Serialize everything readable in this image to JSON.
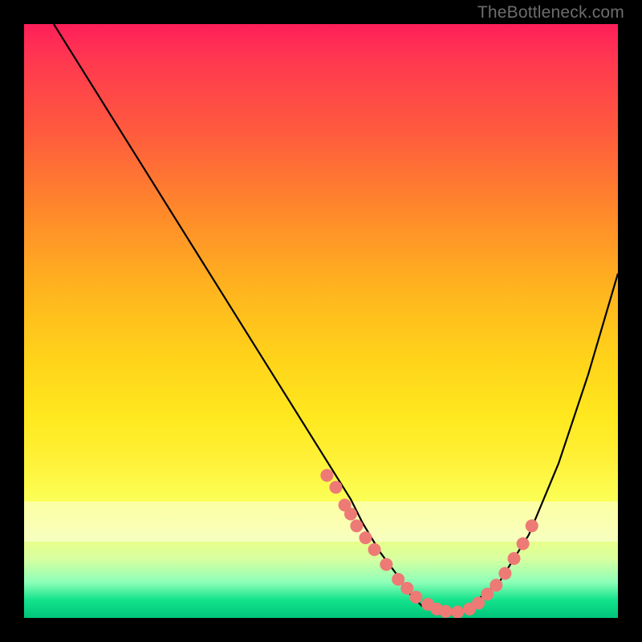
{
  "watermark": "TheBottleneck.com",
  "colors": {
    "background": "#000000",
    "gradient_top": "#ff1f5a",
    "gradient_mid1": "#ff8a2a",
    "gradient_mid2": "#ffe81e",
    "gradient_bottom": "#00c47a",
    "curve": "#000000",
    "markers": "#ed7a75"
  },
  "chart_data": {
    "type": "line",
    "title": "",
    "xlabel": "",
    "ylabel": "",
    "xlim": [
      0,
      100
    ],
    "ylim": [
      0,
      100
    ],
    "grid": false,
    "legend": false,
    "series": [
      {
        "name": "curve",
        "x": [
          5,
          10,
          15,
          20,
          25,
          30,
          35,
          40,
          45,
          50,
          55,
          57,
          60,
          63,
          65,
          67,
          70,
          73,
          75,
          80,
          85,
          90,
          95,
          100
        ],
        "y": [
          100,
          92,
          84,
          76,
          68,
          60,
          52,
          44,
          36,
          28,
          20,
          16,
          11,
          7,
          4,
          2,
          1,
          1,
          2,
          6,
          14,
          26,
          41,
          58
        ]
      }
    ],
    "markers": {
      "name": "bottleneck-zone-markers",
      "x": [
        51,
        52.5,
        54,
        55,
        56,
        57.5,
        59,
        61,
        63,
        64.5,
        66,
        68,
        69.5,
        71,
        73,
        75,
        76.5,
        78,
        79.5,
        81,
        82.5,
        84,
        85.5
      ],
      "y": [
        24,
        22,
        19,
        17.5,
        15.5,
        13.5,
        11.5,
        9,
        6.5,
        5,
        3.5,
        2.3,
        1.5,
        1.1,
        1.0,
        1.5,
        2.5,
        4,
        5.5,
        7.5,
        10,
        12.5,
        15.5
      ]
    }
  }
}
